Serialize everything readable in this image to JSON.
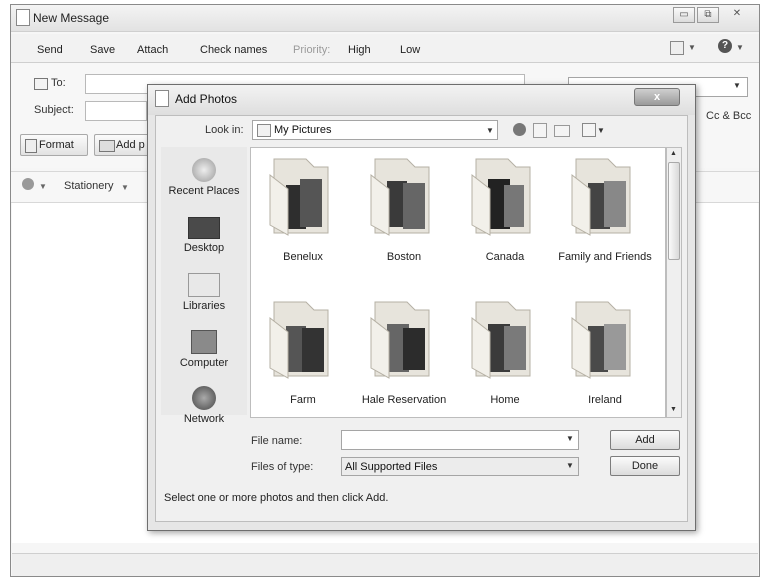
{
  "window": {
    "title": "New Message",
    "controls": [
      "▭",
      "⧉",
      "✕"
    ]
  },
  "toolbar": {
    "items": [
      "Send",
      "Save",
      "Attach",
      "Check names",
      "Priority:",
      "High",
      "Low"
    ]
  },
  "compose": {
    "to_label": "To:",
    "subject_label": "Subject:",
    "cc_bcc": "Cc & Bcc",
    "format_button": "Format",
    "add_photos_button": "Add p",
    "stationery": "Stationery"
  },
  "dialog": {
    "title": "Add Photos",
    "close_label": "x",
    "look_in_label": "Look in:",
    "look_in_value": "My Pictures",
    "places": [
      "Recent Places",
      "Desktop",
      "Libraries",
      "Computer",
      "Network"
    ],
    "folders": [
      "Benelux",
      "Boston",
      "Canada",
      "Family and Friends",
      "Farm",
      "Hale Reservation",
      "Home",
      "Ireland"
    ],
    "file_name_label": "File name:",
    "file_name_value": "",
    "file_type_label": "Files of type:",
    "file_type_value": "All Supported Files",
    "add_button": "Add",
    "done_button": "Done",
    "hint": "Select one or more photos and then click Add."
  }
}
